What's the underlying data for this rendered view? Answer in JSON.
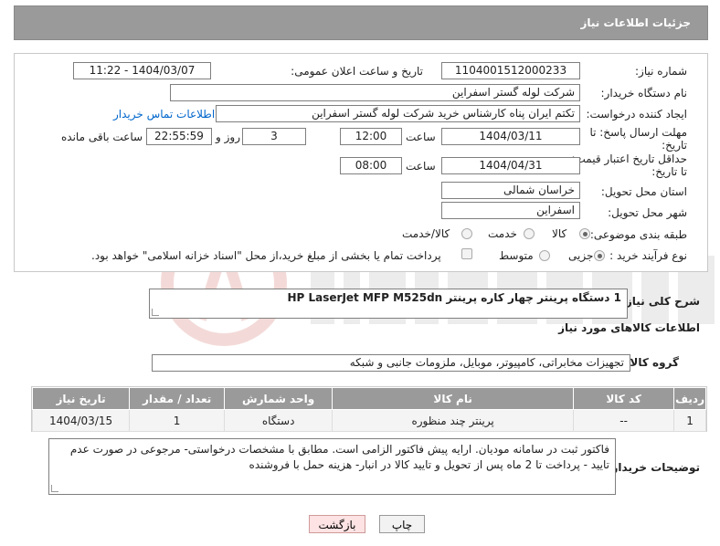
{
  "header": {
    "title": "جزئیات اطلاعات نیاز"
  },
  "form": {
    "need_number_label": "شماره نیاز:",
    "need_number": "1104001512000233",
    "announce_label": "تاریخ و ساعت اعلان عمومی:",
    "announce_value": "1404/03/07 - 11:22",
    "buyer_label": "نام دستگاه خریدار:",
    "buyer": "شرکت لوله گستر اسفراین",
    "creator_label": "ایجاد کننده درخواست:",
    "creator": "تکتم ایران پناه کارشناس خرید شرکت لوله گستر اسفراین",
    "contact_link": "اطلاعات تماس خریدار",
    "reply_deadline_label_1": "مهلت ارسال پاسخ: تا",
    "reply_deadline_label_2": "تاریخ:",
    "reply_date": "1404/03/11",
    "time_label": "ساعت",
    "reply_time": "12:00",
    "days_value": "3",
    "days_label": "روز و",
    "remaining_time": "22:55:59",
    "remaining_label": "ساعت باقی مانده",
    "validity_label_1": "حداقل تاریخ اعتبار قیمت:",
    "validity_label_2": "تا تاریخ:",
    "validity_date": "1404/04/31",
    "validity_time": "08:00",
    "province_label": "استان محل تحویل:",
    "province": "خراسان شمالی",
    "city_label": "شهر محل تحویل:",
    "city": "اسفراین",
    "category_label": "طبقه بندی موضوعی:",
    "category_options": [
      "کالا",
      "خدمت",
      "کالا/خدمت"
    ],
    "process_label": "نوع فرآیند خرید :",
    "process_options": [
      "جزیی",
      "متوسط"
    ],
    "payment_note": "پرداخت تمام یا بخشی از مبلغ خرید،از محل \"اسناد خزانه اسلامی\" خواهد بود."
  },
  "description": {
    "label": "شرح کلی نیاز:",
    "text": "1 دستگاه پرینتر چهار کاره  پرینتر HP LaserJet MFP M525dn"
  },
  "goods": {
    "section_title": "اطلاعات کالاهای مورد نیاز",
    "group_label": "گروه کالا:",
    "group_value": "تجهیزات مخابراتی، کامپیوتر، موبایل، ملزومات جانبی و شبکه",
    "columns": [
      "ردیف",
      "کد کالا",
      "نام کالا",
      "واحد شمارش",
      "تعداد / مقدار",
      "تاریخ نیاز"
    ],
    "rows": [
      {
        "row": "1",
        "code": "--",
        "name": "پرینتر چند منظوره",
        "unit": "دستگاه",
        "qty": "1",
        "date": "1404/03/15"
      }
    ]
  },
  "buyer_notes": {
    "label": "توضیحات خریدار:",
    "text": "فاکتور ثبت در سامانه مودیان. ارایه پیش فاکتور الزامی است. مطابق با مشخصات درخواستی- مرجوعی در صورت عدم تایید - پرداخت تا 2 ماه پس از تحویل و تایید کالا در انبار- هزینه حمل با فروشنده"
  },
  "buttons": {
    "print": "چاپ",
    "back": "بازگشت"
  },
  "colors": {
    "header_bg": "#9a9a9a",
    "link": "#0066cc",
    "back_button_bg": "#fde3e3"
  }
}
